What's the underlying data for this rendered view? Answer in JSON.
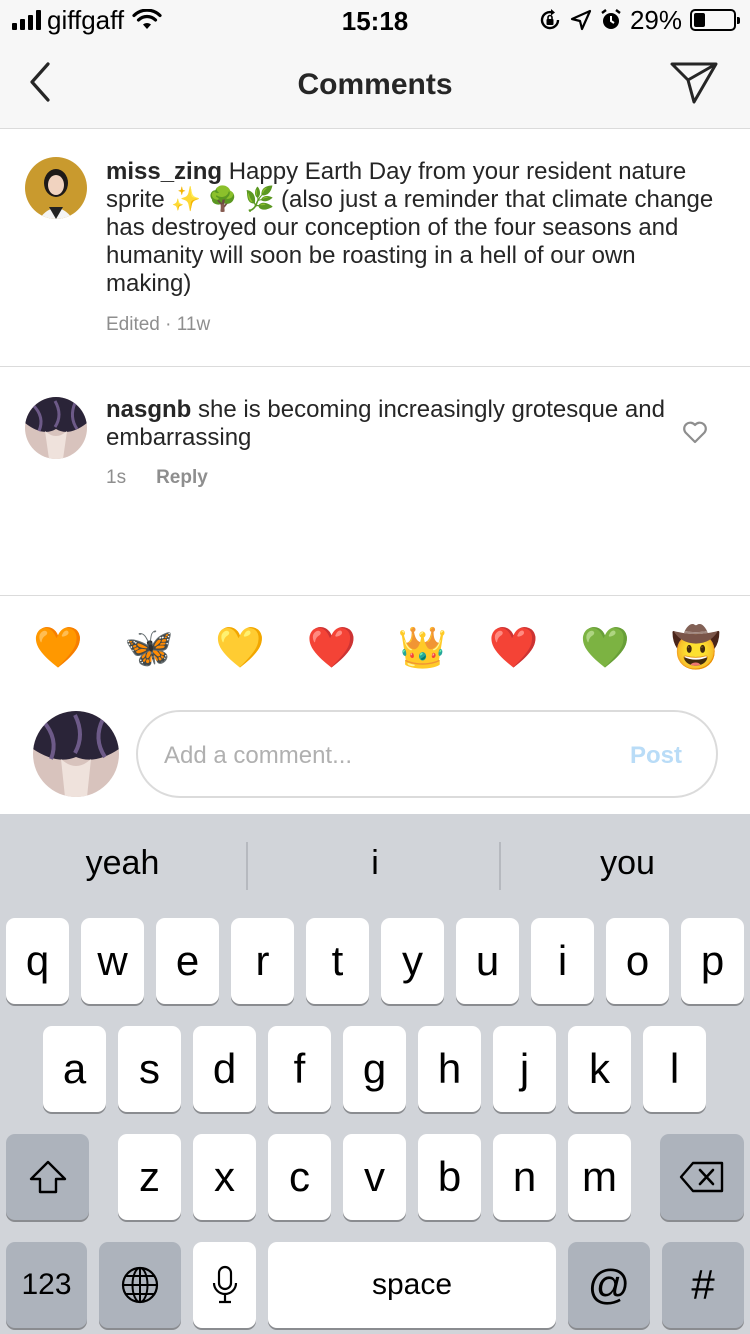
{
  "status_bar": {
    "carrier": "giffgaff",
    "time": "15:18",
    "battery_percent": "29%",
    "battery_level": 0.29,
    "icons": [
      "signal-icon",
      "wifi-icon",
      "rotation-lock-icon",
      "location-icon",
      "alarm-icon",
      "battery-icon"
    ]
  },
  "nav": {
    "title": "Comments",
    "back_icon": "chevron-left-icon",
    "send_icon": "paper-plane-icon"
  },
  "caption": {
    "username": "miss_zing",
    "text": " Happy Earth Day from your resident nature sprite ✨ 🌳 🌿  (also just a reminder that climate change has destroyed our conception of the four seasons and humanity will soon be roasting in a hell of our own making)",
    "meta": "Edited · 11w"
  },
  "comment": {
    "username": "nasgnb",
    "text": " she is becoming increasingly grotesque and embarrassing",
    "time": "1s",
    "reply_label": "Reply"
  },
  "emoji_bar": [
    "🧡",
    "🦋",
    "💛",
    "❤️",
    "👑",
    "❤️",
    "💚",
    "🤠"
  ],
  "input": {
    "placeholder": "Add a comment...",
    "post_label": "Post",
    "post_color": "#b9dcf7"
  },
  "keyboard": {
    "suggestions": [
      "yeah",
      "i",
      "you"
    ],
    "row1": [
      "q",
      "w",
      "e",
      "r",
      "t",
      "y",
      "u",
      "i",
      "o",
      "p"
    ],
    "row2": [
      "a",
      "s",
      "d",
      "f",
      "g",
      "h",
      "j",
      "k",
      "l"
    ],
    "row3": [
      "z",
      "x",
      "c",
      "v",
      "b",
      "n",
      "m"
    ],
    "numbers_label": "123",
    "space_label": "space",
    "at_label": "@",
    "hash_label": "#"
  }
}
